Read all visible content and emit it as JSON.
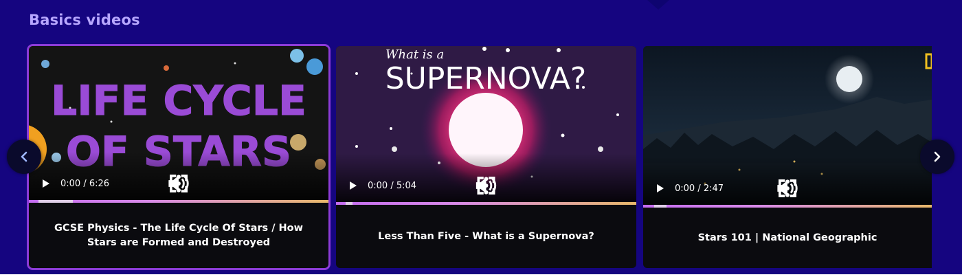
{
  "section": {
    "title": "Basics videos"
  },
  "colors": {
    "background": "#150580",
    "title": "#b7a7ff",
    "active_border": "#8c3bd8",
    "card_bg": "#0b0b0f"
  },
  "nav": {
    "prev_icon": "chevron-left-icon",
    "next_icon": "chevron-right-icon"
  },
  "videos": [
    {
      "thumbnail_text_line1": "LIFE CYCLE",
      "thumbnail_text_line2": "OF STARS",
      "time": "0:00 / 6:26",
      "caption": "GCSE Physics - The Life Cycle Of Stars / How Stars are Formed and Destroyed",
      "active": true
    },
    {
      "thumbnail_text_small": "What is a",
      "thumbnail_text_big": "SUPERNOVA?",
      "time": "0:00 / 5:04",
      "caption": "Less Than Five - What is a Supernova?",
      "active": false
    },
    {
      "time": "0:00 / 2:47",
      "caption": "Stars 101 | National Geographic",
      "active": false
    }
  ]
}
